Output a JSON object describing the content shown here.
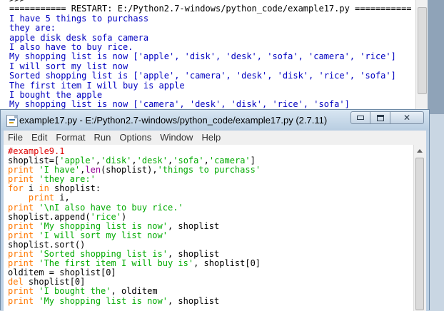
{
  "shell": {
    "lines": [
      {
        "text": ">>>",
        "tone": "dark"
      },
      {
        "text": "=========== RESTART: E:/Python2.7-windows/python_code/example17.py ===========",
        "tone": "dark"
      },
      {
        "text": "I have 5 things to purchass",
        "tone": "blue"
      },
      {
        "text": "they are:",
        "tone": "blue"
      },
      {
        "text": "apple disk desk sofa camera",
        "tone": "blue"
      },
      {
        "text": "I also have to buy rice.",
        "tone": "blue"
      },
      {
        "text": "My shopping list is now ['apple', 'disk', 'desk', 'sofa', 'camera', 'rice']",
        "tone": "blue"
      },
      {
        "text": "I will sort my list now",
        "tone": "blue"
      },
      {
        "text": "Sorted shopping list is ['apple', 'camera', 'desk', 'disk', 'rice', 'sofa']",
        "tone": "blue"
      },
      {
        "text": "The first item I will buy is apple",
        "tone": "blue"
      },
      {
        "text": "I bought the apple",
        "tone": "blue"
      },
      {
        "text": "My shopping list is now ['camera', 'desk', 'disk', 'rice', 'sofa']",
        "tone": "blue"
      }
    ]
  },
  "editor": {
    "title": "example17.py - E:/Python2.7-windows/python_code/example17.py (2.7.11)",
    "icon": "idle-file-icon",
    "window_buttons": {
      "minimize": "minimize-icon",
      "maximize": "maximize-icon",
      "close": "close-icon",
      "close_glyph": "✕"
    },
    "menu": [
      "File",
      "Edit",
      "Format",
      "Run",
      "Options",
      "Window",
      "Help"
    ],
    "code_lines": [
      [
        {
          "t": "#example9.1",
          "c": "comment"
        }
      ],
      [
        {
          "t": "shoplist=[",
          "c": "plain"
        },
        {
          "t": "'apple'",
          "c": "str"
        },
        {
          "t": ",",
          "c": "plain"
        },
        {
          "t": "'disk'",
          "c": "str"
        },
        {
          "t": ",",
          "c": "plain"
        },
        {
          "t": "'desk'",
          "c": "str"
        },
        {
          "t": ",",
          "c": "plain"
        },
        {
          "t": "'sofa'",
          "c": "str"
        },
        {
          "t": ",",
          "c": "plain"
        },
        {
          "t": "'camera'",
          "c": "str"
        },
        {
          "t": "]",
          "c": "plain"
        }
      ],
      [
        {
          "t": "print ",
          "c": "kw"
        },
        {
          "t": "'I have'",
          "c": "str"
        },
        {
          "t": ",",
          "c": "plain"
        },
        {
          "t": "len",
          "c": "builtin"
        },
        {
          "t": "(shoplist),",
          "c": "plain"
        },
        {
          "t": "'things to purchass'",
          "c": "str"
        }
      ],
      [
        {
          "t": "print ",
          "c": "kw"
        },
        {
          "t": "'they are:'",
          "c": "str"
        }
      ],
      [
        {
          "t": "for",
          "c": "kw"
        },
        {
          "t": " i ",
          "c": "plain"
        },
        {
          "t": "in",
          "c": "kw"
        },
        {
          "t": " shoplist:",
          "c": "plain"
        }
      ],
      [
        {
          "t": "    ",
          "c": "plain"
        },
        {
          "t": "print",
          "c": "kw"
        },
        {
          "t": " i,",
          "c": "plain"
        }
      ],
      [
        {
          "t": "print ",
          "c": "kw"
        },
        {
          "t": "'\\nI also have to buy rice.'",
          "c": "str"
        }
      ],
      [
        {
          "t": "shoplist.append(",
          "c": "plain"
        },
        {
          "t": "'rice'",
          "c": "str"
        },
        {
          "t": ")",
          "c": "plain"
        }
      ],
      [
        {
          "t": "print ",
          "c": "kw"
        },
        {
          "t": "'My shopping list is now'",
          "c": "str"
        },
        {
          "t": ", shoplist",
          "c": "plain"
        }
      ],
      [
        {
          "t": "print ",
          "c": "kw"
        },
        {
          "t": "'I will sort my list now'",
          "c": "str"
        }
      ],
      [
        {
          "t": "shoplist.sort()",
          "c": "plain"
        }
      ],
      [
        {
          "t": "print ",
          "c": "kw"
        },
        {
          "t": "'Sorted shopping list is'",
          "c": "str"
        },
        {
          "t": ", shoplist",
          "c": "plain"
        }
      ],
      [
        {
          "t": "print ",
          "c": "kw"
        },
        {
          "t": "'The first item I will buy is'",
          "c": "str"
        },
        {
          "t": ", shoplist[0]",
          "c": "plain"
        }
      ],
      [
        {
          "t": "olditem = shoplist[0]",
          "c": "plain"
        }
      ],
      [
        {
          "t": "del",
          "c": "kw"
        },
        {
          "t": " shoplist[0]",
          "c": "plain"
        }
      ],
      [
        {
          "t": "print ",
          "c": "kw"
        },
        {
          "t": "'I bought the'",
          "c": "str"
        },
        {
          "t": ", olditem",
          "c": "plain"
        }
      ],
      [
        {
          "t": "print ",
          "c": "kw"
        },
        {
          "t": "'My shopping list is now'",
          "c": "str"
        },
        {
          "t": ", shoplist",
          "c": "plain"
        }
      ]
    ]
  }
}
